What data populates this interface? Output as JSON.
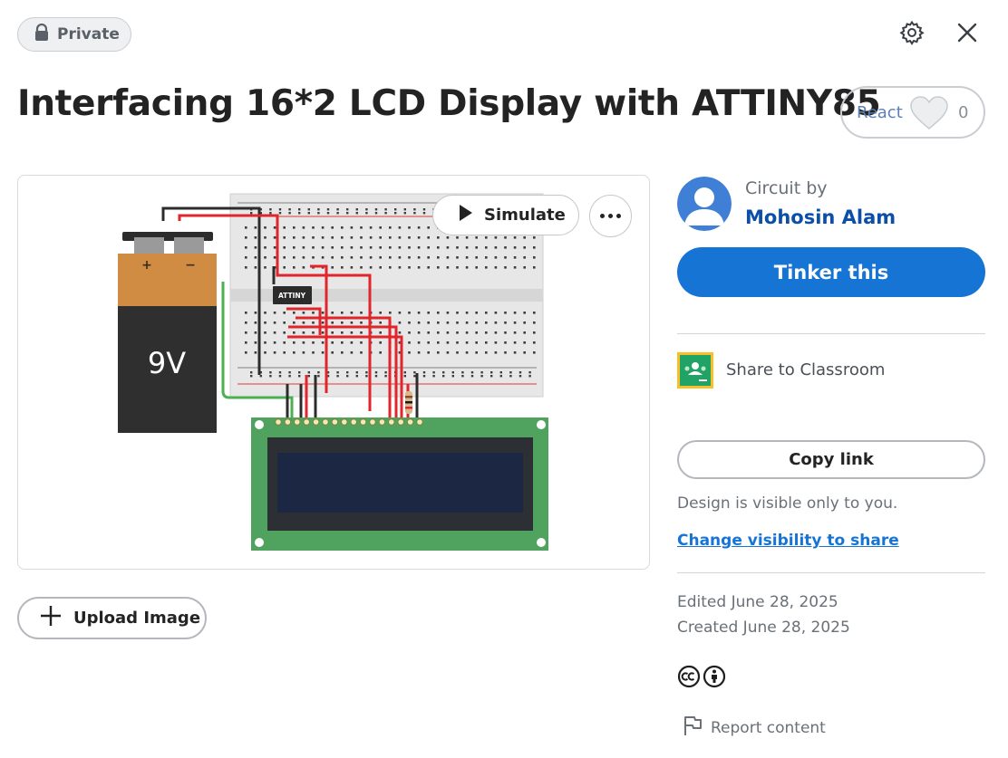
{
  "header": {
    "privacy_badge": "Private",
    "settings_icon": "gear-icon",
    "close_icon": "close-icon"
  },
  "project": {
    "title": "Interfacing 16*2 LCD Display with ATTINY85",
    "react_label": "React",
    "react_count": "0"
  },
  "preview": {
    "simulate_label": "Simulate",
    "chip_label": "ATTINY",
    "battery_label": "9V",
    "battery_plus": "+",
    "battery_minus": "−"
  },
  "upload": {
    "label": "Upload Image"
  },
  "author": {
    "caption": "Circuit by",
    "name": "Mohosin Alam"
  },
  "actions": {
    "tinker_label": "Tinker this",
    "share_classroom_label": "Share to Classroom",
    "copy_link_label": "Copy link",
    "visibility_note": "Design is visible only to you.",
    "change_visibility_label": "Change visibility to share"
  },
  "meta": {
    "edited": "Edited June 28, 2025",
    "created": "Created June 28, 2025",
    "report_label": "Report content"
  },
  "colors": {
    "accent": "#1674d4",
    "author_link": "#0b4fa8",
    "breadboard": "#e6e6e6",
    "lcd_pcb": "#4fa35f",
    "lcd_screen": "#1c2744",
    "battery_cap": "#d18c43",
    "wire_red": "#e0262b",
    "wire_green": "#4caf50"
  }
}
